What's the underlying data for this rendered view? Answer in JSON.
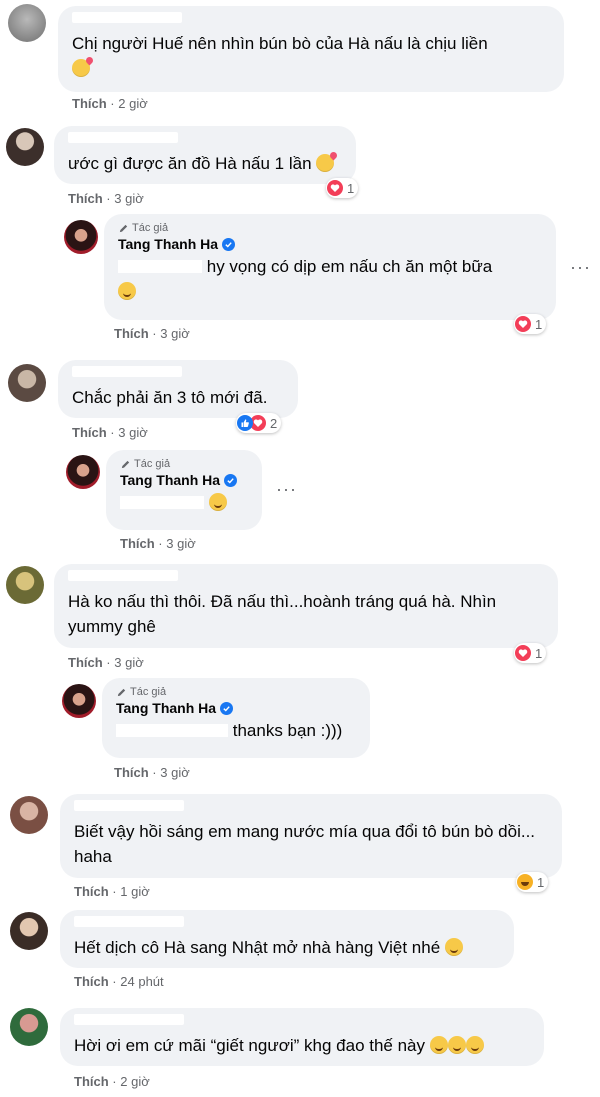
{
  "comments": [
    {
      "text": "Chị người Huế nên nhìn bún bò của Hà nấu là chịu liền",
      "like_label": "Thích",
      "time": "2 giờ"
    },
    {
      "text": "ước gì được ăn đồ Hà nấu 1 lần",
      "like_label": "Thích",
      "time": "3 giờ",
      "reaction_count": "1"
    },
    {
      "text": "Chắc phải ăn 3 tô mới đã.",
      "like_label": "Thích",
      "time": "3 giờ",
      "reaction_count": "2"
    },
    {
      "text": "Hà ko nấu thì thôi. Đã nấu thì...hoành tráng quá hà. Nhìn yummy ghê",
      "like_label": "Thích",
      "time": "3 giờ",
      "reaction_count": "1"
    },
    {
      "text": "Biết vậy hồi sáng em mang nước mía qua đổi tô bún bò dồi... haha",
      "like_label": "Thích",
      "time": "1 giờ",
      "reaction_count": "1"
    },
    {
      "text": "Hết dịch cô Hà sang Nhật mở nhà hàng Việt nhé",
      "like_label": "Thích",
      "time": "24 phút"
    },
    {
      "text": "Hời ơi em cứ mãi “giết ngươi” khg đao thế này",
      "like_label": "Thích",
      "time": "2 giờ"
    }
  ],
  "replies": [
    {
      "author_badge": "Tác giả",
      "author": "Tang Thanh Ha",
      "text": "hy vọng có dịp em nấu ch ăn một bữa",
      "like_label": "Thích",
      "time": "3 giờ",
      "reaction_count": "1",
      "more": "···"
    },
    {
      "author_badge": "Tác giả",
      "author": "Tang Thanh Ha",
      "text": "",
      "like_label": "Thích",
      "time": "3 giờ",
      "more": "···"
    },
    {
      "author_badge": "Tác giả",
      "author": "Tang Thanh Ha",
      "text": "thanks bạn :)))",
      "like_label": "Thích",
      "time": "3 giờ"
    }
  ],
  "separator": "·",
  "colors": {
    "bubble": "#f0f2f5",
    "heart": "#f33e58",
    "like": "#1877f2",
    "haha": "#f7b125",
    "meta": "#65676b"
  },
  "icons": {
    "verified": "verified-badge-icon",
    "author": "pencil-icon",
    "more": "more-icon"
  }
}
